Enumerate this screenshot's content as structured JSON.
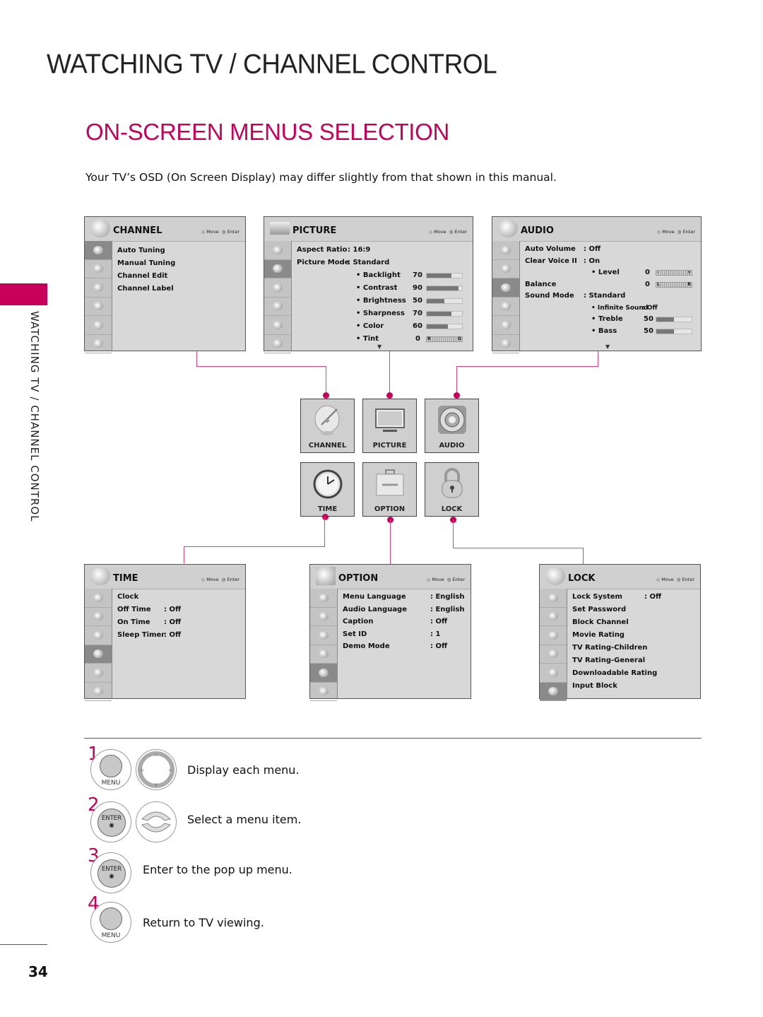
{
  "header": {
    "section_title": "WATCHING TV / CHANNEL CONTROL",
    "page_title": "ON-SCREEN MENUS SELECTION",
    "intro": "Your TV’s OSD (On Screen Display) may differ slightly from that shown in this manual.",
    "side_label": "WATCHING TV / CHANNEL CONTROL"
  },
  "nav_hint": {
    "move": "Move",
    "enter": "Enter"
  },
  "colors": {
    "accent": "#c8005a",
    "connector": "#d6457f",
    "osd_bg": "#d8d8d8"
  },
  "menus": {
    "channel": {
      "title": "CHANNEL",
      "items": [
        "Auto Tuning",
        "Manual Tuning",
        "Channel Edit",
        "Channel Label"
      ]
    },
    "picture": {
      "title": "PICTURE",
      "settings": [
        {
          "label": "Aspect Ratio",
          "value": ": 16:9"
        },
        {
          "label": "Picture Mode",
          "value": ": Standard"
        }
      ],
      "sliders": [
        {
          "label": "• Backlight",
          "value": "70",
          "fraction": 0.7
        },
        {
          "label": "• Contrast",
          "value": "90",
          "fraction": 0.9
        },
        {
          "label": "• Brightness",
          "value": "50",
          "fraction": 0.5
        },
        {
          "label": "• Sharpness",
          "value": "70",
          "fraction": 0.7
        },
        {
          "label": "• Color",
          "value": "60",
          "fraction": 0.6
        }
      ],
      "tint": {
        "label": "• Tint",
        "value": "0",
        "left": "R",
        "right": "G"
      }
    },
    "audio": {
      "title": "AUDIO",
      "auto_volume": {
        "label": "Auto Volume",
        "value": ": Off"
      },
      "clear_voice": {
        "label": "Clear Voice II",
        "value": ": On"
      },
      "level": {
        "label": "• Level",
        "value": "0",
        "left": "-",
        "right": "+"
      },
      "balance": {
        "label": "Balance",
        "value": "0",
        "left": "L",
        "right": "R"
      },
      "sound_mode": {
        "label": "Sound Mode",
        "value": ": Standard"
      },
      "infinite": {
        "label": "• Infinite Sound",
        "value": ": Off"
      },
      "treble": {
        "label": "• Treble",
        "value": "50",
        "fraction": 0.5
      },
      "bass": {
        "label": "• Bass",
        "value": "50",
        "fraction": 0.5
      }
    },
    "time": {
      "title": "TIME",
      "items": [
        {
          "label": "Clock",
          "value": ""
        },
        {
          "label": "Off Time",
          "value": ": Off"
        },
        {
          "label": "On Time",
          "value": ": Off"
        },
        {
          "label": "Sleep Timer",
          "value": ": Off"
        }
      ]
    },
    "option": {
      "title": "OPTION",
      "items": [
        {
          "label": "Menu Language",
          "value": ": English"
        },
        {
          "label": "Audio Language",
          "value": ": English"
        },
        {
          "label": "Caption",
          "value": ": Off"
        },
        {
          "label": "Set ID",
          "value": ": 1"
        },
        {
          "label": "Demo Mode",
          "value": ": Off"
        }
      ]
    },
    "lock": {
      "title": "LOCK",
      "items": [
        {
          "label": "Lock System",
          "value": ": Off"
        },
        {
          "label": "Set Password",
          "value": ""
        },
        {
          "label": "Block Channel",
          "value": ""
        },
        {
          "label": "Movie Rating",
          "value": ""
        },
        {
          "label": "TV Rating-Children",
          "value": ""
        },
        {
          "label": "TV Rating-General",
          "value": ""
        },
        {
          "label": "Downloadable Rating",
          "value": ""
        },
        {
          "label": "Input Block",
          "value": ""
        }
      ]
    }
  },
  "main_menu_tiles": [
    "CHANNEL",
    "PICTURE",
    "AUDIO",
    "TIME",
    "OPTION",
    "LOCK"
  ],
  "steps": [
    {
      "num": "1",
      "button": "MENU",
      "text": "Display each menu."
    },
    {
      "num": "2",
      "button": "ENTER",
      "text": "Select a menu item."
    },
    {
      "num": "3",
      "button": "ENTER",
      "text": "Enter to the pop up menu."
    },
    {
      "num": "4",
      "button": "MENU",
      "text": "Return to TV viewing."
    }
  ],
  "page_number": "34"
}
